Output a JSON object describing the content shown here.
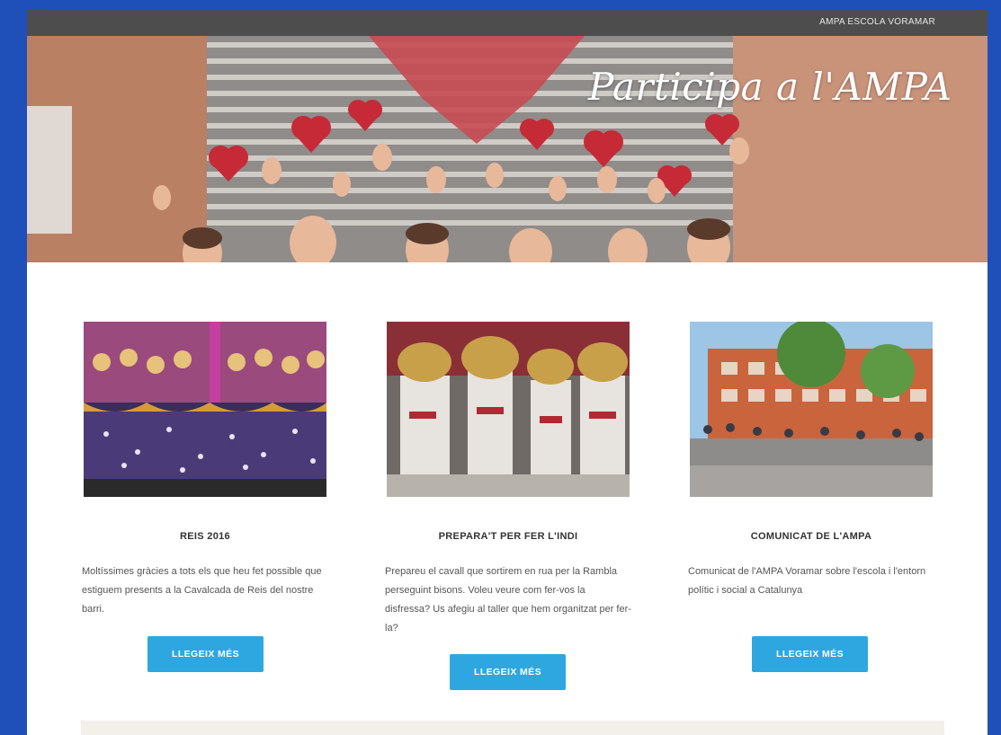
{
  "header": {
    "site_name": "AMPA ESCOLA VORAMAR"
  },
  "hero": {
    "title": "Participa a l'AMPA"
  },
  "cards": [
    {
      "title": "REIS 2016",
      "body": "Moltíssimes gràcies a tots els que heu fet possible que estiguem presents a la Cavalcada de Reis del nostre barri.",
      "button": "LLEGEIX MÉS"
    },
    {
      "title": "PREPARA'T PER FER L'INDI",
      "body": "Prepareu el cavall que sortirem en rua per la Rambla perseguint bisons. Voleu veure com fer-vos la disfressa? Us afegiu al taller que hem organitzat per fer-la?",
      "button": "LLEGEIX MÉS"
    },
    {
      "title": "COMUNICAT DE L'AMPA",
      "body": "Comunicat de l'AMPA Voramar sobre l'escola i l'entorn polític i social a Catalunya",
      "button": "LLEGEIX MÉS"
    }
  ],
  "colors": {
    "accent": "#2ea7e0",
    "topbar": "#4d4d4d",
    "frame": "#1f4fb8"
  }
}
